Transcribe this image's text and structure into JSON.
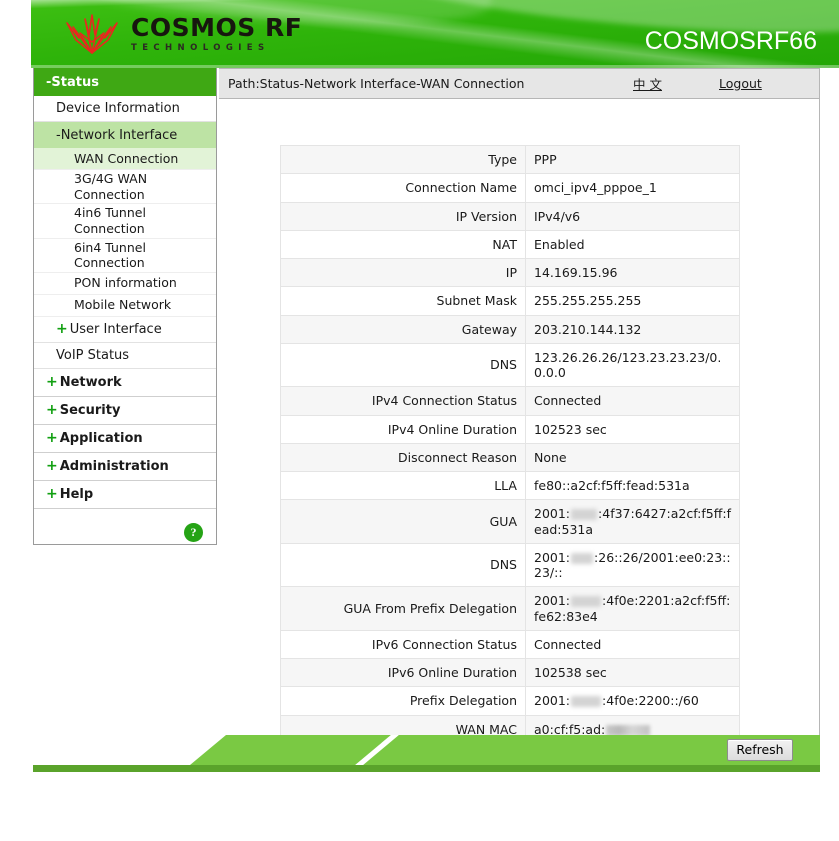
{
  "header": {
    "logo_name": "COSMOS RF",
    "logo_sub": "TECHNOLOGIES",
    "logo_icon": "red-star-leaf-logo",
    "device_name": "COSMOSRF66"
  },
  "sidebar": {
    "status": {
      "label": "-Status"
    },
    "device_information": {
      "label": "Device Information"
    },
    "network_interface": {
      "label": "-Network Interface"
    },
    "sub_items": [
      {
        "label": "WAN Connection"
      },
      {
        "label": "3G/4G WAN Connection"
      },
      {
        "label": "4in6 Tunnel Connection"
      },
      {
        "label": "6in4 Tunnel Connection"
      },
      {
        "label": "PON information"
      },
      {
        "label": "Mobile Network"
      }
    ],
    "user_interface": {
      "plus": "+",
      "label": "User Interface"
    },
    "voip_status": {
      "label": "VoIP Status"
    },
    "groups": [
      {
        "plus": "+",
        "label": "Network"
      },
      {
        "plus": "+",
        "label": "Security"
      },
      {
        "plus": "+",
        "label": "Application"
      },
      {
        "plus": "+",
        "label": "Administration"
      },
      {
        "plus": "+",
        "label": "Help"
      }
    ],
    "help_button": {
      "label": "?"
    }
  },
  "pathbar": {
    "path": "Path:Status-Network Interface-WAN Connection",
    "language_link": "中 文",
    "logout_link": "Logout"
  },
  "table": {
    "rows": [
      {
        "key": "Type",
        "value": "PPP"
      },
      {
        "key": "Connection Name",
        "value": "omci_ipv4_pppoe_1"
      },
      {
        "key": "IP Version",
        "value": "IPv4/v6"
      },
      {
        "key": "NAT",
        "value": "Enabled"
      },
      {
        "key": "IP",
        "value": "14.169.15.96"
      },
      {
        "key": "Subnet Mask",
        "value": "255.255.255.255"
      },
      {
        "key": "Gateway",
        "value": "203.210.144.132"
      },
      {
        "key": "DNS",
        "value": "123.26.26.26/123.23.23.23/0.0.0.0"
      },
      {
        "key": "IPv4 Connection Status",
        "value": "Connected"
      },
      {
        "key": "IPv4 Online Duration",
        "value": "102523 sec"
      },
      {
        "key": "Disconnect Reason",
        "value": "None"
      },
      {
        "key": "LLA",
        "value": "fe80::a2cf:f5ff:fead:531a"
      },
      {
        "key": "GUA",
        "value_prefix": "2001:",
        "redacted": true,
        "value_suffix": ":4f37:6427:a2cf:f5ff:fead:531a"
      },
      {
        "key": "DNS",
        "value_prefix": "2001:",
        "redacted": true,
        "value_suffix": ":26::26/2001:ee0:23::23/::"
      },
      {
        "key": "GUA From Prefix Delegation",
        "value_prefix": "2001:",
        "redacted": true,
        "value_suffix": ":4f0e:2201:a2cf:f5ff:fe62:83e4"
      },
      {
        "key": "IPv6 Connection Status",
        "value": "Connected"
      },
      {
        "key": "IPv6 Online Duration",
        "value": "102538 sec"
      },
      {
        "key": "Prefix Delegation",
        "value_prefix": "2001:",
        "redacted": true,
        "value_suffix": ":4f0e:2200::/60"
      },
      {
        "key": "WAN MAC",
        "value_prefix": "a0:cf:f5:ad:",
        "redacted_mac": true,
        "value_suffix": ""
      }
    ]
  },
  "footer": {
    "refresh_label": "Refresh"
  },
  "colors": {
    "banner_green": "#2fb40a",
    "nav_active_green": "#3fa814",
    "nav_selected_green": "#bde3a4",
    "nav_sub_selected_green": "#e2f3d7",
    "footer_band": "#7ac943",
    "footer_dark": "#5aa32b",
    "plus_green": "#12a012",
    "logo_red": "#e8281e"
  }
}
